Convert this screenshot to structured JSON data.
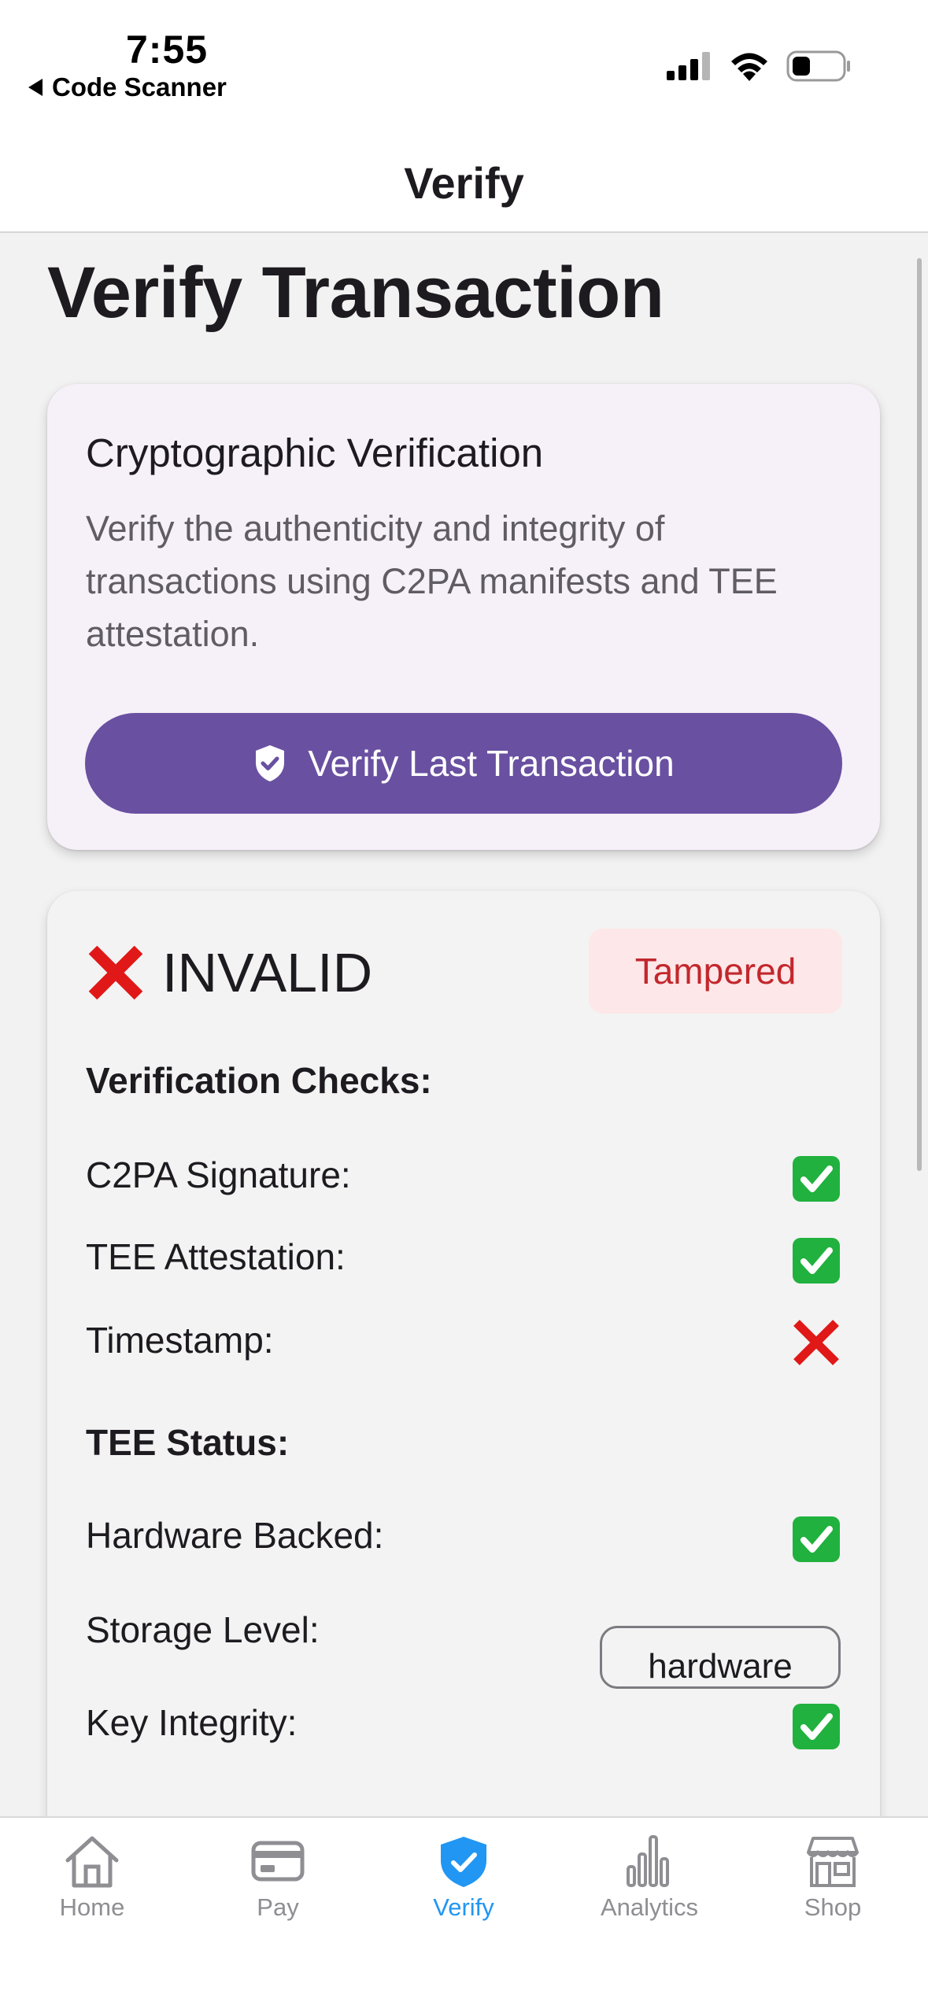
{
  "status_bar": {
    "time": "7:55",
    "back_app": "Code Scanner"
  },
  "header": {
    "title": "Verify"
  },
  "page": {
    "title": "Verify Transaction"
  },
  "crypto_card": {
    "title": "Cryptographic Verification",
    "description": "Verify the authenticity and integrity of transactions using C2PA manifests and TEE attestation.",
    "button_label": "Verify Last Transaction"
  },
  "result_card": {
    "status": "INVALID",
    "badge": "Tampered",
    "checks_heading": "Verification Checks:",
    "checks": [
      {
        "label": "C2PA Signature:",
        "result": "pass"
      },
      {
        "label": "TEE Attestation:",
        "result": "pass"
      },
      {
        "label": "Timestamp:",
        "result": "fail"
      }
    ],
    "tee_heading": "TEE Status:",
    "tee": {
      "hardware_backed_label": "Hardware Backed:",
      "hardware_backed": "pass",
      "storage_level_label": "Storage Level:",
      "storage_level_value": "hardware",
      "key_integrity_label": "Key Integrity:",
      "key_integrity": "pass"
    }
  },
  "colors": {
    "accent": "#6950a1",
    "active_tab": "#2196f3",
    "danger": "#e01818",
    "success": "#21b13e"
  },
  "tabs": [
    {
      "label": "Home",
      "icon": "home-icon"
    },
    {
      "label": "Pay",
      "icon": "card-icon"
    },
    {
      "label": "Verify",
      "icon": "shield-check-icon",
      "active": true
    },
    {
      "label": "Analytics",
      "icon": "bar-chart-icon"
    },
    {
      "label": "Shop",
      "icon": "store-icon"
    }
  ]
}
